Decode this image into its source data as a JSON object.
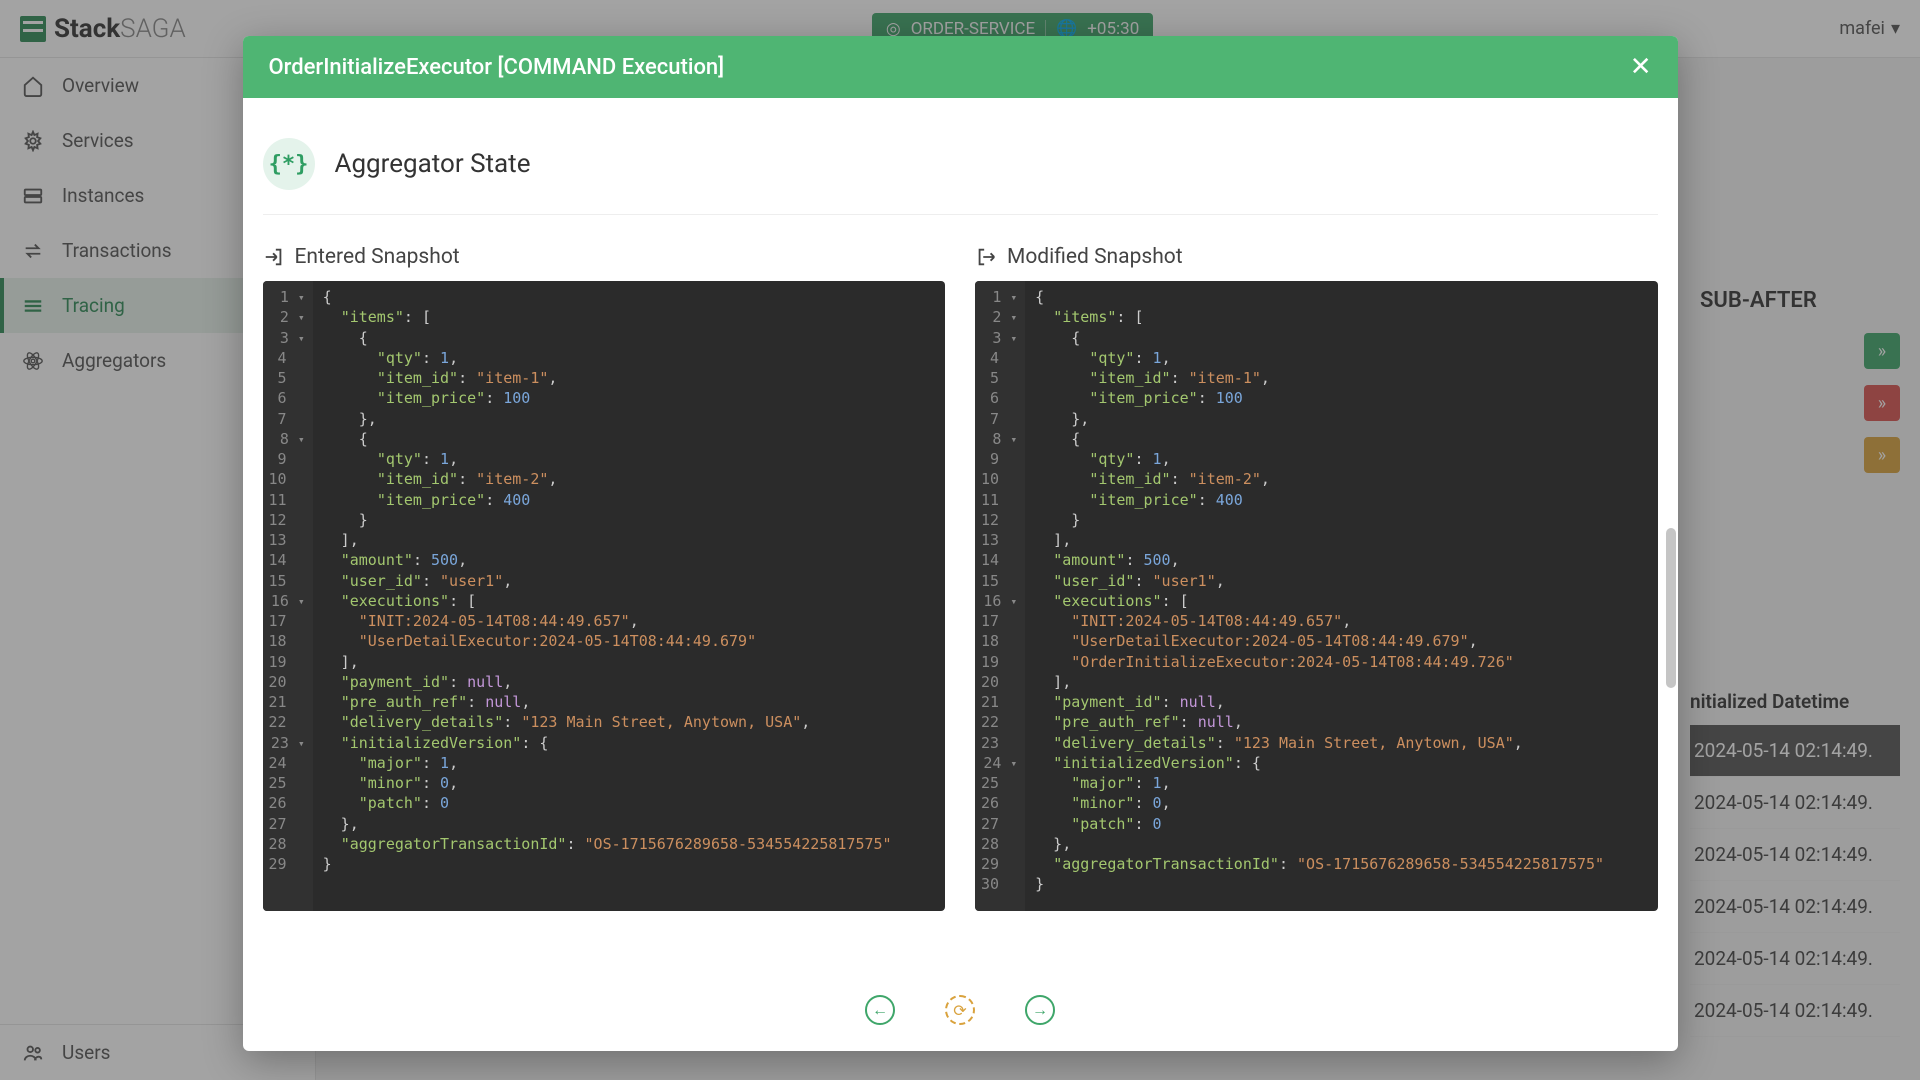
{
  "brand": {
    "bold": "Stack",
    "light": "SAGA"
  },
  "service_badge": {
    "name": "ORDER-SERVICE",
    "tz": "+05:30"
  },
  "user": {
    "name": "mafei"
  },
  "sidebar": {
    "items": [
      {
        "label": "Overview",
        "icon": "home"
      },
      {
        "label": "Services",
        "icon": "gear"
      },
      {
        "label": "Instances",
        "icon": "server"
      },
      {
        "label": "Transactions",
        "icon": "swap"
      },
      {
        "label": "Tracing",
        "icon": "lines",
        "active": true
      },
      {
        "label": "Aggregators",
        "icon": "atom"
      }
    ],
    "bottom": {
      "label": "Users",
      "icon": "users"
    }
  },
  "modal": {
    "title": "OrderInitializeExecutor [COMMAND Execution]",
    "section_title": "Aggregator State",
    "section_icon": "{*}",
    "entered_label": "Entered Snapshot",
    "modified_label": "Modified Snapshot"
  },
  "background": {
    "subafter": "SUB-AFTER",
    "date_header": "nitialized Datetime",
    "dates": [
      "2024-05-14 02:14:49.",
      "2024-05-14 02:14:49.",
      "2024-05-14 02:14:49.",
      "2024-05-14 02:14:49.",
      "2024-05-14 02:14:49.",
      "2024-05-14 02:14:49."
    ]
  },
  "snapshots": {
    "entered": {
      "items": [
        {
          "qty": 1,
          "item_id": "item-1",
          "item_price": 100
        },
        {
          "qty": 1,
          "item_id": "item-2",
          "item_price": 400
        }
      ],
      "amount": 500,
      "user_id": "user1",
      "executions": [
        "INIT:2024-05-14T08:44:49.657",
        "UserDetailExecutor:2024-05-14T08:44:49.679"
      ],
      "payment_id": null,
      "pre_auth_ref": null,
      "delivery_details": "123 Main Street, Anytown, USA",
      "initializedVersion": {
        "major": 1,
        "minor": 0,
        "patch": 0
      },
      "aggregatorTransactionId": "OS-1715676289658-534554225817575"
    },
    "modified": {
      "items": [
        {
          "qty": 1,
          "item_id": "item-1",
          "item_price": 100
        },
        {
          "qty": 1,
          "item_id": "item-2",
          "item_price": 400
        }
      ],
      "amount": 500,
      "user_id": "user1",
      "executions": [
        "INIT:2024-05-14T08:44:49.657",
        "UserDetailExecutor:2024-05-14T08:44:49.679",
        "OrderInitializeExecutor:2024-05-14T08:44:49.726"
      ],
      "payment_id": null,
      "pre_auth_ref": null,
      "delivery_details": "123 Main Street, Anytown, USA",
      "initializedVersion": {
        "major": 1,
        "minor": 0,
        "patch": 0
      },
      "aggregatorTransactionId": "OS-1715676289658-534554225817575"
    }
  }
}
